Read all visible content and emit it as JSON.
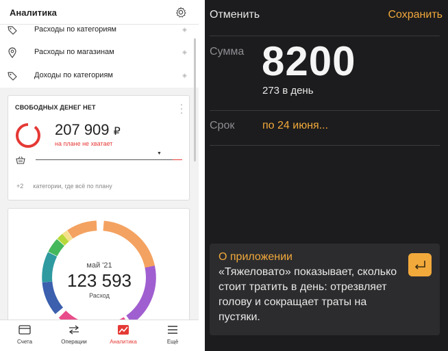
{
  "left": {
    "header": {
      "title": "Аналитика",
      "settings_icon": "gear-icon"
    },
    "menu": [
      {
        "label": "Расходы по категориям",
        "icon": "tag-icon"
      },
      {
        "label": "Расходы по магазинам",
        "icon": "location-pin-icon"
      },
      {
        "label": "Доходы по категориям",
        "icon": "tag-icon"
      }
    ],
    "free_money_card": {
      "title": "СВОБОДНЫХ ДЕНЕГ НЕТ",
      "amount": "207 909",
      "currency": "₽",
      "subtitle": "на плане не хватает",
      "on_plan_count": "+2",
      "on_plan_text": "категории, где всё по плану",
      "accent": "#e53935"
    },
    "chart_card": {
      "month": "май '21",
      "amount": "123 593",
      "label": "Расход"
    },
    "tabs": [
      {
        "label": "Счета",
        "icon": "wallet-icon",
        "active": false
      },
      {
        "label": "Операции",
        "icon": "transfer-arrows-icon",
        "active": false
      },
      {
        "label": "Аналитика",
        "icon": "analytics-chart-icon",
        "active": true
      },
      {
        "label": "Ещё",
        "icon": "menu-icon",
        "active": false
      }
    ]
  },
  "right": {
    "cancel_label": "Отменить",
    "save_label": "Сохранить",
    "sum_label": "Сумма",
    "sum_value": "8200",
    "per_day": "273 в день",
    "term_label": "Срок",
    "term_value": "по 24 июня...",
    "about_title": "О приложении",
    "about_text": "«Тяжеловато» показывает, сколько стоит тратить в день: отрезвляет голову и сокращает траты на пустяки.",
    "about_button_icon": "return-icon",
    "accent": "#f2a93b"
  }
}
